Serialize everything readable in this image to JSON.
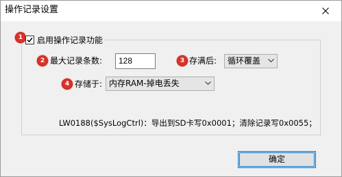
{
  "window": {
    "title": "操作记录设置"
  },
  "group": {
    "enable_label": "启用操作记录功能",
    "enabled": true
  },
  "badges": [
    "1",
    "2",
    "3",
    "4"
  ],
  "fields": {
    "max_records_label": "最大记录条数:",
    "max_records_value": "128",
    "when_full_label": "存满后:",
    "when_full_value": "循环覆盖",
    "storage_label": "存储于:",
    "storage_value": "内存RAM-掉电丢失"
  },
  "info": "LW0188($SysLogCtrl)：导出到SD卡写0x0001；清除记录写0x0055；",
  "buttons": {
    "ok_label": "确定"
  },
  "icons": {
    "close": "close-icon",
    "check": "check-icon",
    "dropdown": "chevron-down-icon"
  }
}
